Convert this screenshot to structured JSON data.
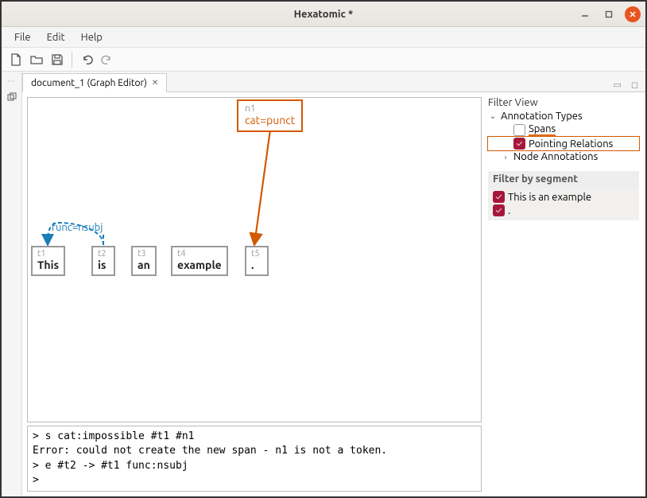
{
  "window": {
    "title": "Hexatomic *"
  },
  "menu": {
    "file": "File",
    "edit": "Edit",
    "help": "Help"
  },
  "tab": {
    "label": "document_1 (Graph Editor)"
  },
  "node": {
    "id": "n1",
    "annotation": "cat=punct"
  },
  "edge": {
    "label": "func=nsubj"
  },
  "tokens": {
    "t1": {
      "id": "t1",
      "word": "This"
    },
    "t2": {
      "id": "t2",
      "word": "is"
    },
    "t3": {
      "id": "t3",
      "word": "an"
    },
    "t4": {
      "id": "t4",
      "word": "example"
    },
    "t5": {
      "id": "t5",
      "word": "."
    }
  },
  "filter": {
    "heading": "Filter View",
    "annotation_types_label": "Annotation Types",
    "spans_label": "Spans",
    "pointing_relations_label": "Pointing Relations",
    "node_annotations_label": "Node Annotations",
    "by_segment_label": "Filter by segment",
    "segment1": "This is an example",
    "segment2": "."
  },
  "console": {
    "line1": "> s cat:impossible #t1 #n1",
    "line2": "Error: could not create the new span - n1 is not a token.",
    "line3": "> e #t2 -> #t1 func:nsubj",
    "line4": ">"
  }
}
